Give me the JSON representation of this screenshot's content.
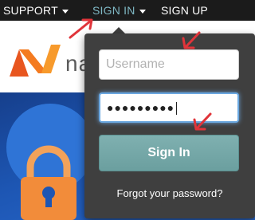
{
  "nav": {
    "support": "SUPPORT",
    "sign_in": "SIGN IN",
    "sign_up": "SIGN UP"
  },
  "brand": {
    "text_visible": "na"
  },
  "login": {
    "username_placeholder": "Username",
    "password_masked": "●●●●●●●●●",
    "submit_label": "Sign In",
    "forgot_link": "Forgot your password?"
  },
  "colors": {
    "nav_bg": "#1b1b1b",
    "active_nav": "#7fb8c4",
    "dropdown_bg": "#3f3f3f",
    "button_teal": "#6b9f9f",
    "annotation_red": "#e0343a",
    "hero_blue": "#1d56b3",
    "logo_orange": "#f47b20"
  },
  "icons": [
    "caret-down-icon",
    "logo-mark-icon",
    "padlock-icon",
    "annotation-arrow-icon"
  ]
}
